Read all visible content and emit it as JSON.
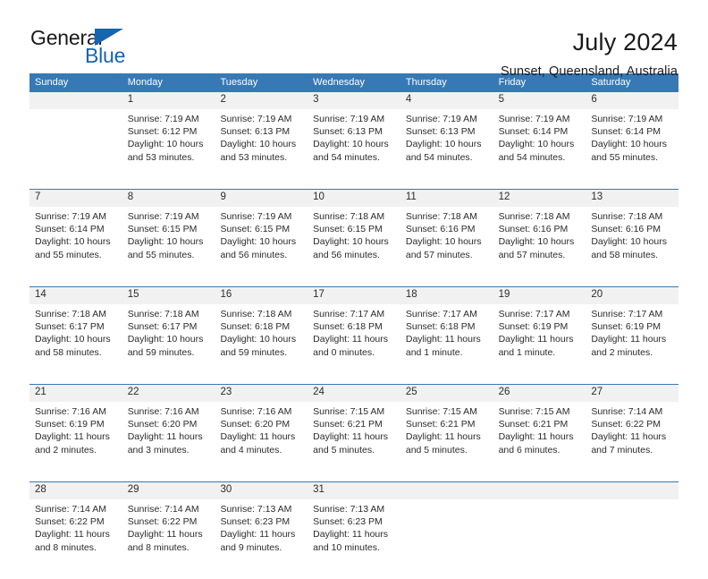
{
  "brand": {
    "line1": "General",
    "line2": "Blue",
    "accent_color": "#1565b0",
    "triangle_icon": "brand-triangle-icon"
  },
  "header": {
    "title": "July 2024",
    "subtitle": "Sunset, Queensland, Australia"
  },
  "calendar": {
    "header_bg": "#3679b5",
    "daynum_band_bg": "#f1f1f1",
    "weekday_headers": [
      "Sunday",
      "Monday",
      "Tuesday",
      "Wednesday",
      "Thursday",
      "Friday",
      "Saturday"
    ],
    "weeks": [
      {
        "days": [
          {
            "num": "",
            "sunrise": "",
            "sunset": "",
            "daylight_line1": "",
            "daylight_line2": ""
          },
          {
            "num": "1",
            "sunrise": "Sunrise: 7:19 AM",
            "sunset": "Sunset: 6:12 PM",
            "daylight_line1": "Daylight: 10 hours",
            "daylight_line2": "and 53 minutes."
          },
          {
            "num": "2",
            "sunrise": "Sunrise: 7:19 AM",
            "sunset": "Sunset: 6:13 PM",
            "daylight_line1": "Daylight: 10 hours",
            "daylight_line2": "and 53 minutes."
          },
          {
            "num": "3",
            "sunrise": "Sunrise: 7:19 AM",
            "sunset": "Sunset: 6:13 PM",
            "daylight_line1": "Daylight: 10 hours",
            "daylight_line2": "and 54 minutes."
          },
          {
            "num": "4",
            "sunrise": "Sunrise: 7:19 AM",
            "sunset": "Sunset: 6:13 PM",
            "daylight_line1": "Daylight: 10 hours",
            "daylight_line2": "and 54 minutes."
          },
          {
            "num": "5",
            "sunrise": "Sunrise: 7:19 AM",
            "sunset": "Sunset: 6:14 PM",
            "daylight_line1": "Daylight: 10 hours",
            "daylight_line2": "and 54 minutes."
          },
          {
            "num": "6",
            "sunrise": "Sunrise: 7:19 AM",
            "sunset": "Sunset: 6:14 PM",
            "daylight_line1": "Daylight: 10 hours",
            "daylight_line2": "and 55 minutes."
          }
        ]
      },
      {
        "days": [
          {
            "num": "7",
            "sunrise": "Sunrise: 7:19 AM",
            "sunset": "Sunset: 6:14 PM",
            "daylight_line1": "Daylight: 10 hours",
            "daylight_line2": "and 55 minutes."
          },
          {
            "num": "8",
            "sunrise": "Sunrise: 7:19 AM",
            "sunset": "Sunset: 6:15 PM",
            "daylight_line1": "Daylight: 10 hours",
            "daylight_line2": "and 55 minutes."
          },
          {
            "num": "9",
            "sunrise": "Sunrise: 7:19 AM",
            "sunset": "Sunset: 6:15 PM",
            "daylight_line1": "Daylight: 10 hours",
            "daylight_line2": "and 56 minutes."
          },
          {
            "num": "10",
            "sunrise": "Sunrise: 7:18 AM",
            "sunset": "Sunset: 6:15 PM",
            "daylight_line1": "Daylight: 10 hours",
            "daylight_line2": "and 56 minutes."
          },
          {
            "num": "11",
            "sunrise": "Sunrise: 7:18 AM",
            "sunset": "Sunset: 6:16 PM",
            "daylight_line1": "Daylight: 10 hours",
            "daylight_line2": "and 57 minutes."
          },
          {
            "num": "12",
            "sunrise": "Sunrise: 7:18 AM",
            "sunset": "Sunset: 6:16 PM",
            "daylight_line1": "Daylight: 10 hours",
            "daylight_line2": "and 57 minutes."
          },
          {
            "num": "13",
            "sunrise": "Sunrise: 7:18 AM",
            "sunset": "Sunset: 6:16 PM",
            "daylight_line1": "Daylight: 10 hours",
            "daylight_line2": "and 58 minutes."
          }
        ]
      },
      {
        "days": [
          {
            "num": "14",
            "sunrise": "Sunrise: 7:18 AM",
            "sunset": "Sunset: 6:17 PM",
            "daylight_line1": "Daylight: 10 hours",
            "daylight_line2": "and 58 minutes."
          },
          {
            "num": "15",
            "sunrise": "Sunrise: 7:18 AM",
            "sunset": "Sunset: 6:17 PM",
            "daylight_line1": "Daylight: 10 hours",
            "daylight_line2": "and 59 minutes."
          },
          {
            "num": "16",
            "sunrise": "Sunrise: 7:18 AM",
            "sunset": "Sunset: 6:18 PM",
            "daylight_line1": "Daylight: 10 hours",
            "daylight_line2": "and 59 minutes."
          },
          {
            "num": "17",
            "sunrise": "Sunrise: 7:17 AM",
            "sunset": "Sunset: 6:18 PM",
            "daylight_line1": "Daylight: 11 hours",
            "daylight_line2": "and 0 minutes."
          },
          {
            "num": "18",
            "sunrise": "Sunrise: 7:17 AM",
            "sunset": "Sunset: 6:18 PM",
            "daylight_line1": "Daylight: 11 hours",
            "daylight_line2": "and 1 minute."
          },
          {
            "num": "19",
            "sunrise": "Sunrise: 7:17 AM",
            "sunset": "Sunset: 6:19 PM",
            "daylight_line1": "Daylight: 11 hours",
            "daylight_line2": "and 1 minute."
          },
          {
            "num": "20",
            "sunrise": "Sunrise: 7:17 AM",
            "sunset": "Sunset: 6:19 PM",
            "daylight_line1": "Daylight: 11 hours",
            "daylight_line2": "and 2 minutes."
          }
        ]
      },
      {
        "days": [
          {
            "num": "21",
            "sunrise": "Sunrise: 7:16 AM",
            "sunset": "Sunset: 6:19 PM",
            "daylight_line1": "Daylight: 11 hours",
            "daylight_line2": "and 2 minutes."
          },
          {
            "num": "22",
            "sunrise": "Sunrise: 7:16 AM",
            "sunset": "Sunset: 6:20 PM",
            "daylight_line1": "Daylight: 11 hours",
            "daylight_line2": "and 3 minutes."
          },
          {
            "num": "23",
            "sunrise": "Sunrise: 7:16 AM",
            "sunset": "Sunset: 6:20 PM",
            "daylight_line1": "Daylight: 11 hours",
            "daylight_line2": "and 4 minutes."
          },
          {
            "num": "24",
            "sunrise": "Sunrise: 7:15 AM",
            "sunset": "Sunset: 6:21 PM",
            "daylight_line1": "Daylight: 11 hours",
            "daylight_line2": "and 5 minutes."
          },
          {
            "num": "25",
            "sunrise": "Sunrise: 7:15 AM",
            "sunset": "Sunset: 6:21 PM",
            "daylight_line1": "Daylight: 11 hours",
            "daylight_line2": "and 5 minutes."
          },
          {
            "num": "26",
            "sunrise": "Sunrise: 7:15 AM",
            "sunset": "Sunset: 6:21 PM",
            "daylight_line1": "Daylight: 11 hours",
            "daylight_line2": "and 6 minutes."
          },
          {
            "num": "27",
            "sunrise": "Sunrise: 7:14 AM",
            "sunset": "Sunset: 6:22 PM",
            "daylight_line1": "Daylight: 11 hours",
            "daylight_line2": "and 7 minutes."
          }
        ]
      },
      {
        "days": [
          {
            "num": "28",
            "sunrise": "Sunrise: 7:14 AM",
            "sunset": "Sunset: 6:22 PM",
            "daylight_line1": "Daylight: 11 hours",
            "daylight_line2": "and 8 minutes."
          },
          {
            "num": "29",
            "sunrise": "Sunrise: 7:14 AM",
            "sunset": "Sunset: 6:22 PM",
            "daylight_line1": "Daylight: 11 hours",
            "daylight_line2": "and 8 minutes."
          },
          {
            "num": "30",
            "sunrise": "Sunrise: 7:13 AM",
            "sunset": "Sunset: 6:23 PM",
            "daylight_line1": "Daylight: 11 hours",
            "daylight_line2": "and 9 minutes."
          },
          {
            "num": "31",
            "sunrise": "Sunrise: 7:13 AM",
            "sunset": "Sunset: 6:23 PM",
            "daylight_line1": "Daylight: 11 hours",
            "daylight_line2": "and 10 minutes."
          },
          {
            "num": "",
            "sunrise": "",
            "sunset": "",
            "daylight_line1": "",
            "daylight_line2": ""
          },
          {
            "num": "",
            "sunrise": "",
            "sunset": "",
            "daylight_line1": "",
            "daylight_line2": ""
          },
          {
            "num": "",
            "sunrise": "",
            "sunset": "",
            "daylight_line1": "",
            "daylight_line2": ""
          }
        ]
      }
    ]
  }
}
